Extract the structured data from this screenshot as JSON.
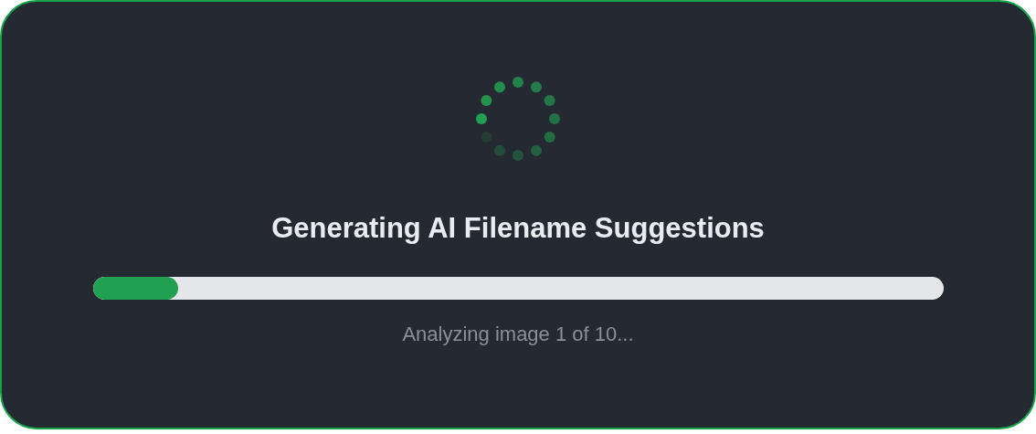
{
  "title": "Generating AI Filename Suggestions",
  "progress": {
    "level": 0.1
  },
  "status": "Analyzing image 1 of 10..."
}
